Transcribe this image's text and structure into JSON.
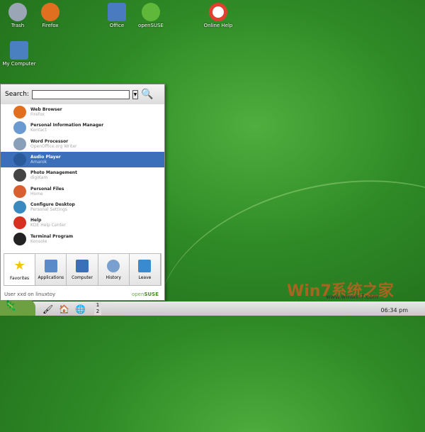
{
  "desktop": {
    "icons": [
      {
        "label": "Trash",
        "color": "#9aa6b6"
      },
      {
        "label": "Firefox",
        "color": "#e07020"
      },
      {
        "label": "Office",
        "color": "#4a7ac0"
      },
      {
        "label": "openSUSE",
        "color": "#5fb83a"
      },
      {
        "label": "Online Help",
        "color": "#e04030"
      },
      {
        "label": "My Computer",
        "color": "#4a80c0"
      }
    ]
  },
  "menu": {
    "search_label": "Search:",
    "search_value": "",
    "items": [
      {
        "title": "Web Browser",
        "sub": "Firefox",
        "color": "#e07020"
      },
      {
        "title": "Personal Information Manager",
        "sub": "Kontact",
        "color": "#6a9ad0"
      },
      {
        "title": "Word Processor",
        "sub": "OpenOffice.org Writer",
        "color": "#8aa0b8"
      },
      {
        "title": "Audio Player",
        "sub": "Amarok",
        "color": "#2a5a9a"
      },
      {
        "title": "Photo Management",
        "sub": "digiKam",
        "color": "#444"
      },
      {
        "title": "Personal Files",
        "sub": "Home",
        "color": "#d86030"
      },
      {
        "title": "Configure Desktop",
        "sub": "Personal Settings",
        "color": "#3a8ac0"
      },
      {
        "title": "Help",
        "sub": "KDE Help Center",
        "color": "#d83020"
      },
      {
        "title": "Terminal Program",
        "sub": "Konsole",
        "color": "#222"
      }
    ],
    "tabs": [
      {
        "label": "Favorites",
        "icon": "star-icon",
        "color": "#f5c400"
      },
      {
        "label": "Applications",
        "icon": "applications-icon",
        "color": "#5a8ac8"
      },
      {
        "label": "Computer",
        "icon": "computer-icon",
        "color": "#3a70b8"
      },
      {
        "label": "History",
        "icon": "clock-icon",
        "color": "#7aa0d0"
      },
      {
        "label": "Leave",
        "icon": "leave-icon",
        "color": "#3a8ad0"
      }
    ],
    "footer_user": "User xxd on linuxtoy",
    "brand_a": "open",
    "brand_b": "SUSE"
  },
  "taskbar": {
    "desktops": [
      "1",
      "2"
    ],
    "clock": "06:34 pm"
  },
  "watermark": {
    "text": "Win7系统之家",
    "url": "www.winwin7.com"
  }
}
